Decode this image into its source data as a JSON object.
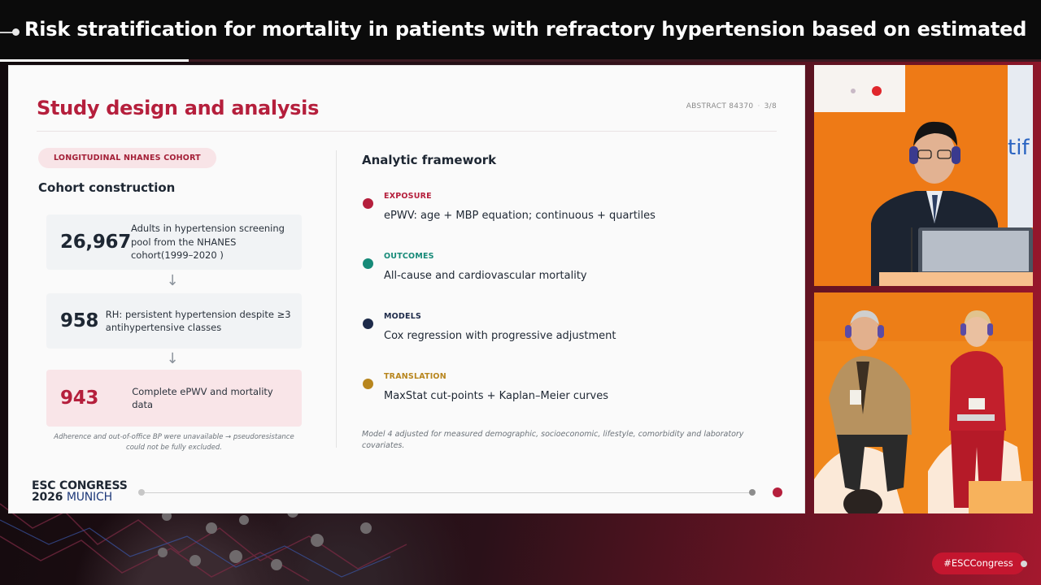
{
  "stream": {
    "title": "Risk stratification for mortality in patients with refractory hypertension based on estimated pulse ...",
    "hashtag": "#ESCCongress"
  },
  "slide": {
    "title": "Study design and analysis",
    "abstract_id": "ABSTRACT 84370",
    "page": "3/8",
    "cohort_tag": "LONGITUDINAL NHANES COHORT",
    "cohort_heading": "Cohort construction",
    "cohort_steps": [
      {
        "number": "26,967",
        "text": "Adults in hypertension screening pool from the NHANES cohort(1999–2020 )"
      },
      {
        "number": "958",
        "text": "RH: persistent hypertension despite ≥3 antihypertensive classes"
      },
      {
        "number": "943",
        "text": "Complete ePWV and mortality data"
      }
    ],
    "arrow_glyph": "↓",
    "cohort_note": "Adherence and out-of-office BP were unavailable → pseudoresistance could not be fully excluded.",
    "framework_heading": "Analytic framework",
    "framework": [
      {
        "label": "EXPOSURE",
        "desc": "ePWV: age + MBP equation; continuous + quartiles",
        "color": "#b51f3c"
      },
      {
        "label": "OUTCOMES",
        "desc": "All-cause and cardiovascular mortality",
        "color": "#168a78"
      },
      {
        "label": "MODELS",
        "desc": "Cox regression with progressive adjustment",
        "color": "#1e2b4a"
      },
      {
        "label": "TRANSLATION",
        "desc": "MaxStat cut-points + Kaplan–Meier curves",
        "color": "#b8861e"
      }
    ],
    "framework_note": "Model 4 adjusted for measured demographic, socioeconomic, lifestyle, comorbidity and laboratory covariates.",
    "logo": {
      "line1": "ESC CONGRESS",
      "year": "2026",
      "city": "MUNICH"
    },
    "backdrop_text": "tif"
  },
  "colors": {
    "accent": "#b51f3c",
    "stage_orange": "#ee7a16"
  }
}
